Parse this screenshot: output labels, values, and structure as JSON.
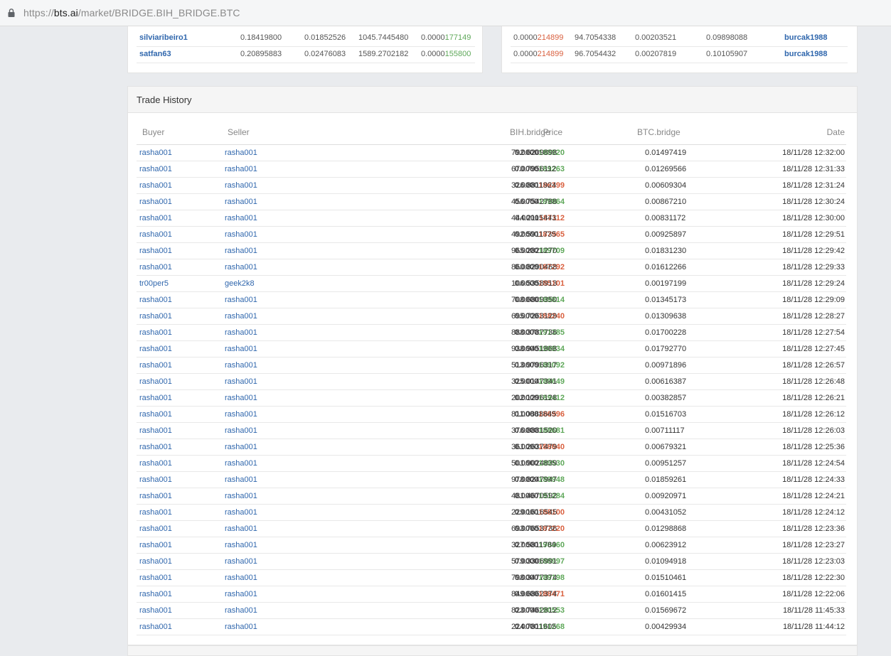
{
  "browser": {
    "url_scheme": "https://",
    "url_host": "bts.ai",
    "url_path": "/market/BRIDGE.BIH_BRIDGE.BTC"
  },
  "bids": [
    {
      "account": "silviaribeiro1",
      "total": "0.18419800",
      "btc": "0.01852526",
      "bih": "1045.7445480",
      "price_lo": "0.0000",
      "price_hi": "177149"
    },
    {
      "account": "satfan63",
      "total": "0.20895883",
      "btc": "0.02476083",
      "bih": "1589.2702182",
      "price_lo": "0.0000",
      "price_hi": "155800"
    }
  ],
  "asks": [
    {
      "price_lo": "0.0000",
      "price_hi": "214899",
      "bih": "94.7054338",
      "btc": "0.00203521",
      "total": "0.09898088",
      "account": "burcak1988"
    },
    {
      "price_lo": "0.0000",
      "price_hi": "214899",
      "bih": "96.7054432",
      "btc": "0.00207819",
      "total": "0.10105907",
      "account": "burcak1988"
    }
  ],
  "trade_history": {
    "title": "Trade History",
    "columns": {
      "buyer": "Buyer",
      "seller": "Seller",
      "price": "Price",
      "bih": "BIH.bridge",
      "btc": "BTC.bridge",
      "date": "Date"
    },
    "colors": {
      "up": "#5fa85a",
      "down": "#d9603f"
    },
    "rows": [
      {
        "buyer": "rasha001",
        "seller": "rasha001",
        "price_lo": "0.0000",
        "price_hi": "188920",
        "dir": "up",
        "bih": "792.6209898",
        "btc": "0.01497419",
        "date": "18/11/28 12:32:00"
      },
      {
        "buyer": "rasha001",
        "seller": "rasha001",
        "price_lo": "0.0000",
        "price_hi": "189263",
        "dir": "up",
        "bih": "670.7956112",
        "btc": "0.01269566",
        "date": "18/11/28 12:31:33"
      },
      {
        "buyer": "rasha001",
        "seller": "rasha001",
        "price_lo": "0.0000",
        "price_hi": "186399",
        "dir": "down",
        "bih": "326.8811924",
        "btc": "0.00609304",
        "date": "18/11/28 12:31:24"
      },
      {
        "buyer": "rasha001",
        "seller": "rasha001",
        "price_lo": "0.0000",
        "price_hi": "189864",
        "dir": "up",
        "bih": "456.7542788",
        "btc": "0.00867210",
        "date": "18/11/28 12:30:24"
      },
      {
        "buyer": "rasha001",
        "seller": "rasha001",
        "price_lo": "0.0000",
        "price_hi": "187112",
        "dir": "down",
        "bih": "444.2115443",
        "btc": "0.00831172",
        "date": "18/11/28 12:30:00"
      },
      {
        "buyer": "rasha001",
        "seller": "rasha001",
        "price_lo": "0.0000",
        "price_hi": "187965",
        "dir": "down",
        "bih": "492.5911735",
        "btc": "0.00925897",
        "date": "18/11/28 12:29:51"
      },
      {
        "buyer": "rasha001",
        "seller": "rasha001",
        "price_lo": "0.0000",
        "price_hi": "189709",
        "dir": "up",
        "bih": "965.2821270",
        "btc": "0.01831230",
        "date": "18/11/28 12:29:42"
      },
      {
        "buyer": "rasha001",
        "seller": "rasha001",
        "price_lo": "0.0000",
        "price_hi": "187292",
        "dir": "down",
        "bih": "860.8290468",
        "btc": "0.01612266",
        "date": "18/11/28 12:29:33"
      },
      {
        "buyer": "tr00per5",
        "seller": "geek2k8",
        "price_lo": "0.0000",
        "price_hi": "185101",
        "dir": "down",
        "bih": "106.5358913",
        "btc": "0.00197199",
        "date": "18/11/28 12:29:24"
      },
      {
        "buyer": "rasha001",
        "seller": "rasha001",
        "price_lo": "0.0000",
        "price_hi": "189814",
        "dir": "up",
        "bih": "708.6809350",
        "btc": "0.01345173",
        "date": "18/11/28 12:29:09"
      },
      {
        "buyer": "rasha001",
        "seller": "rasha001",
        "price_lo": "0.0000",
        "price_hi": "188240",
        "dir": "down",
        "bih": "695.7263129",
        "btc": "0.01309638",
        "date": "18/11/28 12:28:27"
      },
      {
        "buyer": "rasha001",
        "seller": "rasha001",
        "price_lo": "0.0000",
        "price_hi": "191385",
        "dir": "up",
        "bih": "888.3787736",
        "btc": "0.01700228",
        "date": "18/11/28 12:27:54"
      },
      {
        "buyer": "rasha001",
        "seller": "rasha001",
        "price_lo": "0.0000",
        "price_hi": "190934",
        "dir": "up",
        "bih": "938.9451868",
        "btc": "0.01792770",
        "date": "18/11/28 12:27:45"
      },
      {
        "buyer": "rasha001",
        "seller": "rasha001",
        "price_lo": "0.0000",
        "price_hi": "189092",
        "dir": "up",
        "bih": "513.9796317",
        "btc": "0.00971896",
        "date": "18/11/28 12:26:57"
      },
      {
        "buyer": "rasha001",
        "seller": "rasha001",
        "price_lo": "0.0000",
        "price_hi": "189649",
        "dir": "up",
        "bih": "325.0147341",
        "btc": "0.00616387",
        "date": "18/11/28 12:26:48"
      },
      {
        "buyer": "rasha001",
        "seller": "rasha001",
        "price_lo": "0.0000",
        "price_hi": "189412",
        "dir": "up",
        "bih": "202.1296128",
        "btc": "0.00382857",
        "date": "18/11/28 12:26:21"
      },
      {
        "buyer": "rasha001",
        "seller": "rasha001",
        "price_lo": "0.0000",
        "price_hi": "186996",
        "dir": "down",
        "bih": "811.0888645",
        "btc": "0.01516703",
        "date": "18/11/28 12:26:12"
      },
      {
        "buyer": "rasha001",
        "seller": "rasha001",
        "price_lo": "0.0000",
        "price_hi": "188681",
        "dir": "up",
        "bih": "376.8881520",
        "btc": "0.00711117",
        "date": "18/11/28 12:26:03"
      },
      {
        "buyer": "rasha001",
        "seller": "rasha001",
        "price_lo": "0.0000",
        "price_hi": "188040",
        "dir": "down",
        "bih": "361.2637479",
        "btc": "0.00679321",
        "date": "18/11/28 12:25:36"
      },
      {
        "buyer": "rasha001",
        "seller": "rasha001",
        "price_lo": "0.0000",
        "price_hi": "189530",
        "dir": "up",
        "bih": "501.9024839",
        "btc": "0.00951257",
        "date": "18/11/28 12:24:54"
      },
      {
        "buyer": "rasha001",
        "seller": "rasha001",
        "price_lo": "0.0000",
        "price_hi": "189948",
        "dir": "up",
        "bih": "978.8247947",
        "btc": "0.01859261",
        "date": "18/11/28 12:24:33"
      },
      {
        "buyer": "rasha001",
        "seller": "rasha001",
        "price_lo": "0.0000",
        "price_hi": "191284",
        "dir": "up",
        "bih": "481.4670592",
        "btc": "0.00920971",
        "date": "18/11/28 12:24:21"
      },
      {
        "buyer": "rasha001",
        "seller": "rasha001",
        "price_lo": "0.0000",
        "price_hi": "188100",
        "dir": "down",
        "bih": "229.1616545",
        "btc": "0.00431052",
        "date": "18/11/28 12:24:12"
      },
      {
        "buyer": "rasha001",
        "seller": "rasha001",
        "price_lo": "0.0000",
        "price_hi": "187220",
        "dir": "down",
        "bih": "693.7653736",
        "btc": "0.01298868",
        "date": "18/11/28 12:23:36"
      },
      {
        "buyer": "rasha001",
        "seller": "rasha001",
        "price_lo": "0.0000",
        "price_hi": "190460",
        "dir": "up",
        "bih": "327.5811789",
        "btc": "0.00623912",
        "date": "18/11/28 12:23:27"
      },
      {
        "buyer": "rasha001",
        "seller": "rasha001",
        "price_lo": "0.0000",
        "price_hi": "188997",
        "dir": "up",
        "bih": "579.3306991",
        "btc": "0.01094918",
        "date": "18/11/28 12:23:03"
      },
      {
        "buyer": "rasha001",
        "seller": "rasha001",
        "price_lo": "0.0000",
        "price_hi": "189198",
        "dir": "up",
        "bih": "798.3477374",
        "btc": "0.01510461",
        "date": "18/11/28 12:22:30"
      },
      {
        "buyer": "rasha001",
        "seller": "rasha001",
        "price_lo": "0.0000",
        "price_hi": "188471",
        "dir": "down",
        "bih": "849.6862374",
        "btc": "0.01601415",
        "date": "18/11/28 12:22:06"
      },
      {
        "buyer": "rasha001",
        "seller": "rasha001",
        "price_lo": "0.0000",
        "price_hi": "190553",
        "dir": "up",
        "bih": "823.7462812",
        "btc": "0.01569672",
        "date": "18/11/28 11:45:33"
      },
      {
        "buyer": "rasha001",
        "seller": "rasha001",
        "price_lo": "0.0000",
        "price_hi": "191268",
        "dir": "up",
        "bih": "224.7811605",
        "btc": "0.00429934",
        "date": "18/11/28 11:44:12"
      }
    ]
  }
}
